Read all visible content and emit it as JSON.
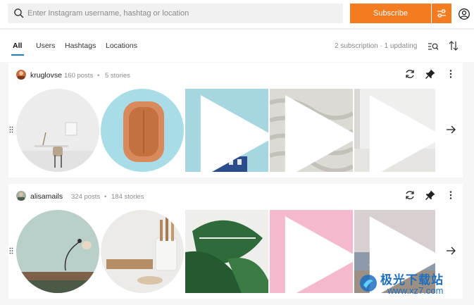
{
  "search": {
    "placeholder": "Enter Instagram username, hashtag or location",
    "value": ""
  },
  "subscribe_label": "Subscribe",
  "accent_color": "#f47c20",
  "tabs": [
    {
      "label": "All",
      "active": true
    },
    {
      "label": "Users",
      "active": false
    },
    {
      "label": "Hashtags",
      "active": false
    },
    {
      "label": "Locations",
      "active": false
    }
  ],
  "subscription_status": "2 subscription · 1 updating",
  "cards": [
    {
      "username": "kruglovse",
      "posts": "160 posts",
      "stories": "5 stories",
      "media": [
        {
          "kind": "story",
          "icon": "desk-chair-room"
        },
        {
          "kind": "story",
          "icon": "orange-bowl"
        },
        {
          "kind": "video",
          "icon": "blue-building"
        },
        {
          "kind": "video",
          "icon": "white-waves"
        },
        {
          "kind": "video",
          "icon": "white-wall"
        }
      ]
    },
    {
      "username": "alisamails",
      "posts": "324 posts",
      "stories": "184 stories",
      "media": [
        {
          "kind": "story",
          "icon": "lamp-wall"
        },
        {
          "kind": "story",
          "icon": "kitchen-utensils"
        },
        {
          "kind": "post",
          "icon": "monstera-leaf"
        },
        {
          "kind": "video",
          "icon": "avocado"
        },
        {
          "kind": "video",
          "icon": "sea-sunset"
        }
      ]
    }
  ],
  "watermark": {
    "text": "极光下载站",
    "url": "www.xz7.com"
  }
}
